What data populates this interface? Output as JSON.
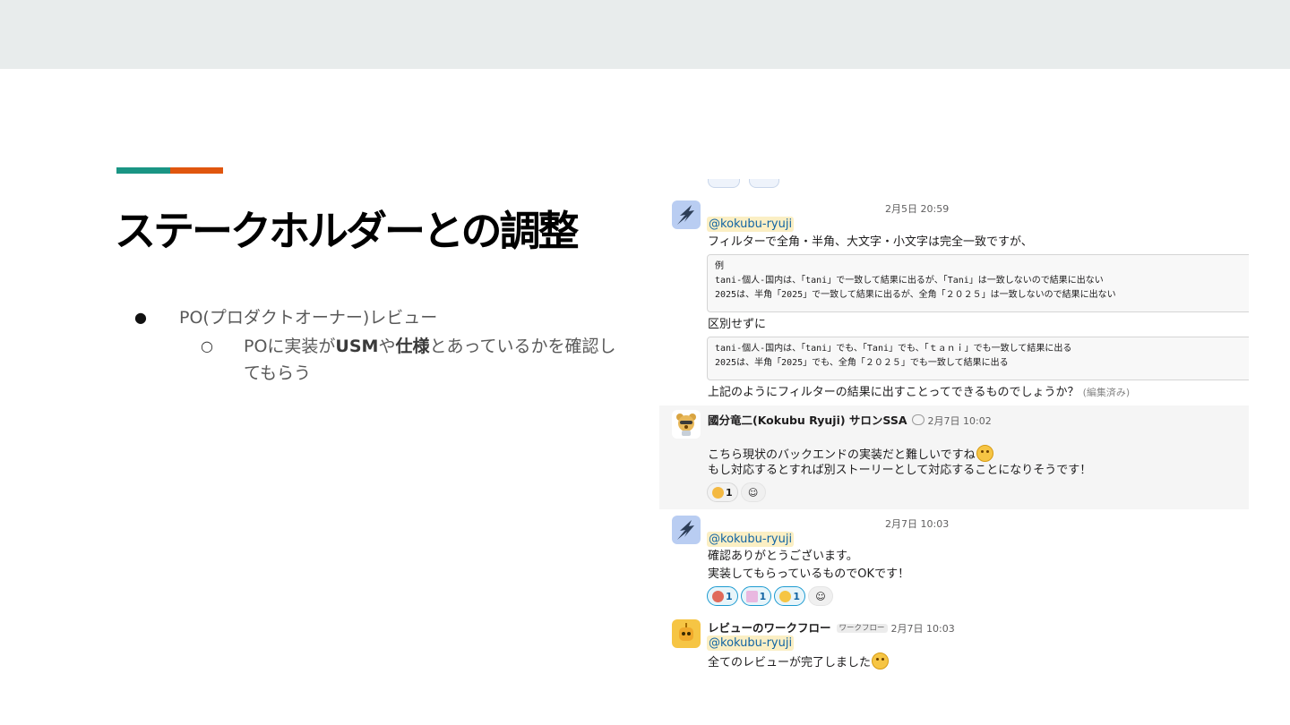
{
  "slide": {
    "title": "ステークホルダーとの調整",
    "accent_colors": [
      "#1a9584",
      "#e0560e"
    ],
    "bullets": {
      "level1": "PO(プロダクトオーナー)レビュー",
      "level2_parts": [
        "POに実装が",
        "USM",
        "や",
        "仕様",
        "とあっているかを確認してもらう"
      ]
    }
  },
  "slack": {
    "messages": [
      {
        "timestamp": "2月5日 20:59",
        "mention": "@kokubu-ryuji",
        "line1": "フィルターで全角・半角、大文字・小文字は完全一致ですが、",
        "code1": [
          "例",
          "tani-個人-国内は、「tani」で一致して結果に出るが、「Tani」は一致しないので結果に出ない",
          "2025は、半角「2025」で一致して結果に出るが、全角「２０２５」は一致しないので結果に出ない"
        ],
        "line2": "区別せずに",
        "code2": [
          "tani-個人-国内は、「tani」でも、「Tani」でも、「ｔａｎｉ」でも一致して結果に出る",
          "2025は、半角「2025」でも、全角「２０２５」でも一致して結果に出る"
        ],
        "line3": "上記のようにフィルターの結果に出すことってできるものでしょうか？",
        "edited": "(編集済み)"
      },
      {
        "author": "國分竜二(Kokubu Ryuji) サロンSSA",
        "timestamp": "2月7日 10:02",
        "line1": "こちら現状のバックエンドの実装だと難しいですね",
        "line2": "もし対応するとすれば別ストーリーとして対応することになりそうです！",
        "reactions": [
          {
            "emoji": "point-left-emoji",
            "count": "1"
          }
        ]
      },
      {
        "timestamp": "2月7日 10:03",
        "mention": "@kokubu-ryuji",
        "line1": "確認ありがとうございます。",
        "line2": "実装してもらっているものでOKです！",
        "reactions": [
          {
            "emoji": "bow-emoji",
            "count": "1"
          },
          {
            "emoji": "acknowledged-emoji",
            "count": "1"
          },
          {
            "emoji": "smile-emoji",
            "count": "1"
          }
        ]
      },
      {
        "author": "レビューのワークフロー",
        "tag": "ワークフロー",
        "timestamp": "2月7日 10:03",
        "mention": "@kokubu-ryuji",
        "line1": "全てのレビューが完了しました"
      }
    ]
  }
}
